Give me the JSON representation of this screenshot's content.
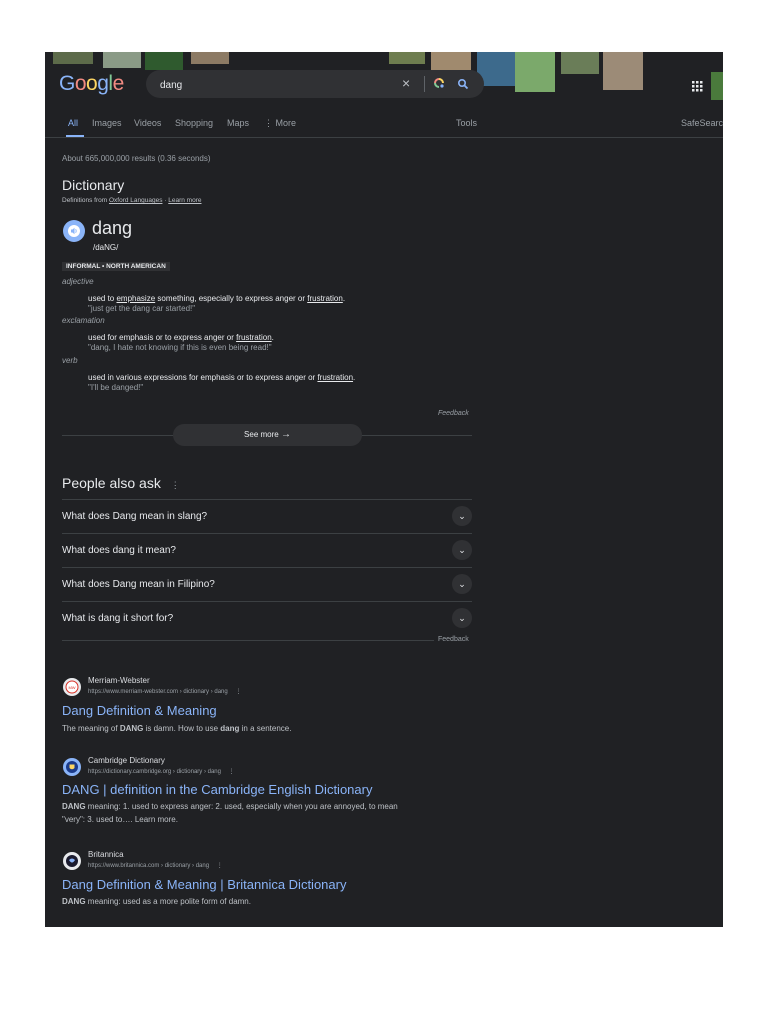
{
  "header": {
    "logo": "Google",
    "query": "dang",
    "colors": {
      "blue": "#8ab4f8",
      "red": "#f28b82",
      "yellow": "#fdd663",
      "green": "#81c995"
    }
  },
  "tabs": [
    {
      "label": "All"
    },
    {
      "label": "Images"
    },
    {
      "label": "Videos"
    },
    {
      "label": "Shopping"
    },
    {
      "label": "Maps"
    },
    {
      "label": "More"
    }
  ],
  "tools_label": "Tools",
  "safesearch_label": "SafeSearch",
  "result_stats": "About 665,000,000 results (0.36 seconds)",
  "dictionary": {
    "heading": "Dictionary",
    "source_prefix": "Definitions from",
    "source_link": "Oxford Languages",
    "sep": "·",
    "learn_more": "Learn more",
    "word": "dang",
    "phonetic": "/daNG/",
    "labels": "INFORMAL • NORTH AMERICAN",
    "pos": [
      {
        "name": "adjective",
        "def_pre": "used to ",
        "def_link1": "emphasize",
        "def_mid": " something, especially to express anger or ",
        "def_link2": "frustration",
        "def_end": ".",
        "example": "\"just get the dang car started!\""
      },
      {
        "name": "exclamation",
        "def_pre": "used for emphasis or to express anger or ",
        "def_link2": "frustration",
        "def_end": ".",
        "example": "\"dang, I hate not knowing if this is even being read!\""
      },
      {
        "name": "verb",
        "def_pre": "used in various expressions for emphasis or to express anger or ",
        "def_link2": "frustration",
        "def_end": ".",
        "example": "\"I'll be danged!\""
      }
    ],
    "feedback": "Feedback",
    "see_more": "See more"
  },
  "paa": {
    "heading": "People also ask",
    "questions": [
      "What does Dang mean in slang?",
      "What does dang it mean?",
      "What does Dang mean in Filipino?",
      "What is dang it short for?"
    ],
    "feedback": "Feedback"
  },
  "results": [
    {
      "site": "Merriam-Webster",
      "url": "https://www.merriam-webster.com › dictionary › dang",
      "title": "Dang Definition & Meaning",
      "snippet_a": "The meaning of ",
      "snippet_b": "DANG",
      "snippet_c": " is damn. How to use ",
      "snippet_d": "dang",
      "snippet_e": " in a sentence."
    },
    {
      "site": "Cambridge Dictionary",
      "url": "https://dictionary.cambridge.org › dictionary › dang",
      "title": "DANG | definition in the Cambridge English Dictionary",
      "snippet_b": "DANG",
      "snippet_c": " meaning: 1. used to express anger: 2. used, especially when you are annoyed, to mean",
      "snippet_line2": "\"very\": 3. used to…. Learn more."
    },
    {
      "site": "Britannica",
      "url": "https://www.britannica.com › dictionary › dang",
      "title": "Dang Definition & Meaning | Britannica Dictionary",
      "snippet_b": "DANG",
      "snippet_c": " meaning: used as a more polite form of damn."
    }
  ]
}
